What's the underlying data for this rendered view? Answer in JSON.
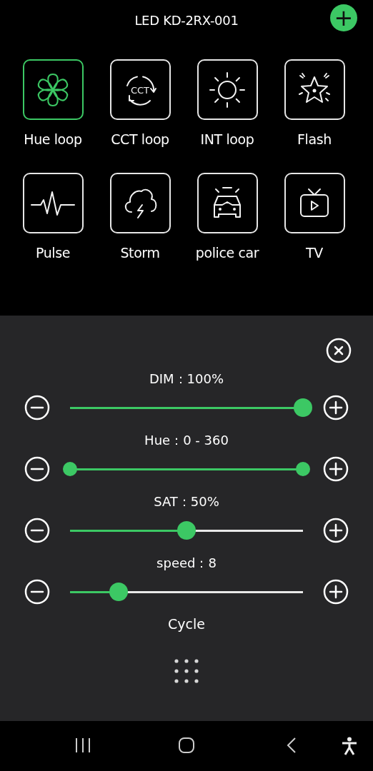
{
  "header": {
    "title": "LED KD-2RX-001",
    "add_button": "+"
  },
  "modes": [
    {
      "label": "Hue loop",
      "selected": true
    },
    {
      "label": "CCT loop",
      "selected": false,
      "icon_text": "CCT"
    },
    {
      "label": "INT loop",
      "selected": false
    },
    {
      "label": "Flash",
      "selected": false
    },
    {
      "label": "Pulse",
      "selected": false
    },
    {
      "label": "Storm",
      "selected": false
    },
    {
      "label": "police car",
      "selected": false
    },
    {
      "label": "TV",
      "selected": false
    }
  ],
  "panel": {
    "sliders": [
      {
        "label": "DIM：100%",
        "kind": "single",
        "level": 1
      },
      {
        "label": "Hue：0 - 360",
        "kind": "range",
        "level": 1
      },
      {
        "label": "SAT：50%",
        "kind": "single",
        "level": 0.5
      },
      {
        "label": "speed：8",
        "kind": "single",
        "level": 0.21
      }
    ],
    "footer_label": "Cycle"
  }
}
